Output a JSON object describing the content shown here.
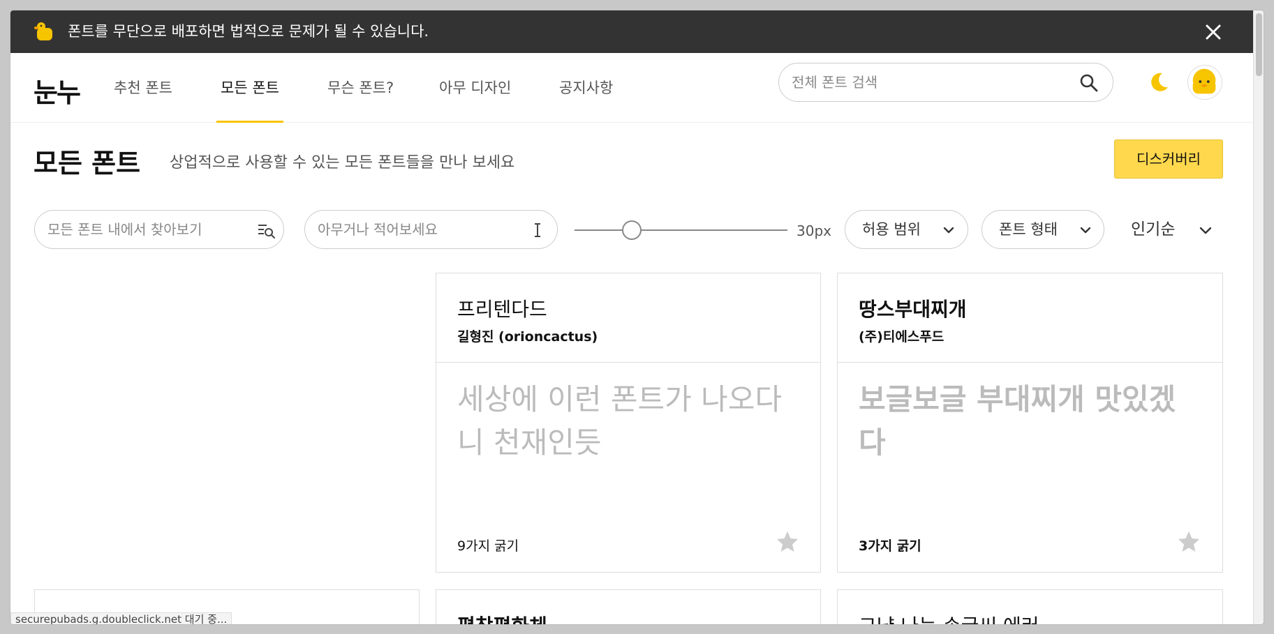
{
  "banner": {
    "message": "폰트를 무단으로 배포하면 법적으로 문제가 될 수 있습니다.",
    "icons": {
      "mascot": "duck-mascot-icon",
      "close": "close-icon"
    }
  },
  "nav": {
    "logo": "눈누",
    "links": [
      {
        "label": "추천 폰트",
        "active": false
      },
      {
        "label": "모든 폰트",
        "active": true
      },
      {
        "label": "무슨 폰트?",
        "active": false
      },
      {
        "label": "아무 디자인",
        "active": false
      },
      {
        "label": "공지사항",
        "active": false
      }
    ],
    "search_placeholder": "전체 폰트 검색",
    "icons": {
      "search": "search-icon",
      "theme": "moon-icon",
      "avatar": "duck-avatar"
    }
  },
  "page": {
    "title": "모든 폰트",
    "subtitle": "상업적으로 사용할 수 있는 모든 폰트들을 만나 보세요",
    "discover_label": "디스커버리"
  },
  "filters": {
    "font_search_placeholder": "모든 폰트 내에서 찾아보기",
    "sample_placeholder": "아무거나 적어보세요",
    "size_value": 30,
    "size_label": "30px",
    "license_label": "허용 범위",
    "form_label": "폰트 형태",
    "sort_label": "인기순"
  },
  "cards": [
    {
      "name": "프리텐다드",
      "author": "길형진 (orioncactus)",
      "sample": "세상에 이런 폰트가 나오다니 천재인듯",
      "weights": "9가지 굵기"
    },
    {
      "name": "땅스부대찌개",
      "author": "(주)티에스푸드",
      "sample": "보글보글 부대찌개 맛있겠다",
      "weights": "3가지 굵기"
    },
    {
      "name": "평창평화체",
      "author": "",
      "sample": "",
      "weights": ""
    },
    {
      "name": "그냥 나는 손글씨 에러",
      "author": "",
      "sample": "",
      "weights": ""
    }
  ],
  "status_bar": "securepubads.g.doubleclick.net 대기 중...",
  "colors": {
    "accent": "#ffd84d",
    "banner_bg": "#333333",
    "underline": "#f7c400",
    "sample_text": "#bbbbbb"
  }
}
